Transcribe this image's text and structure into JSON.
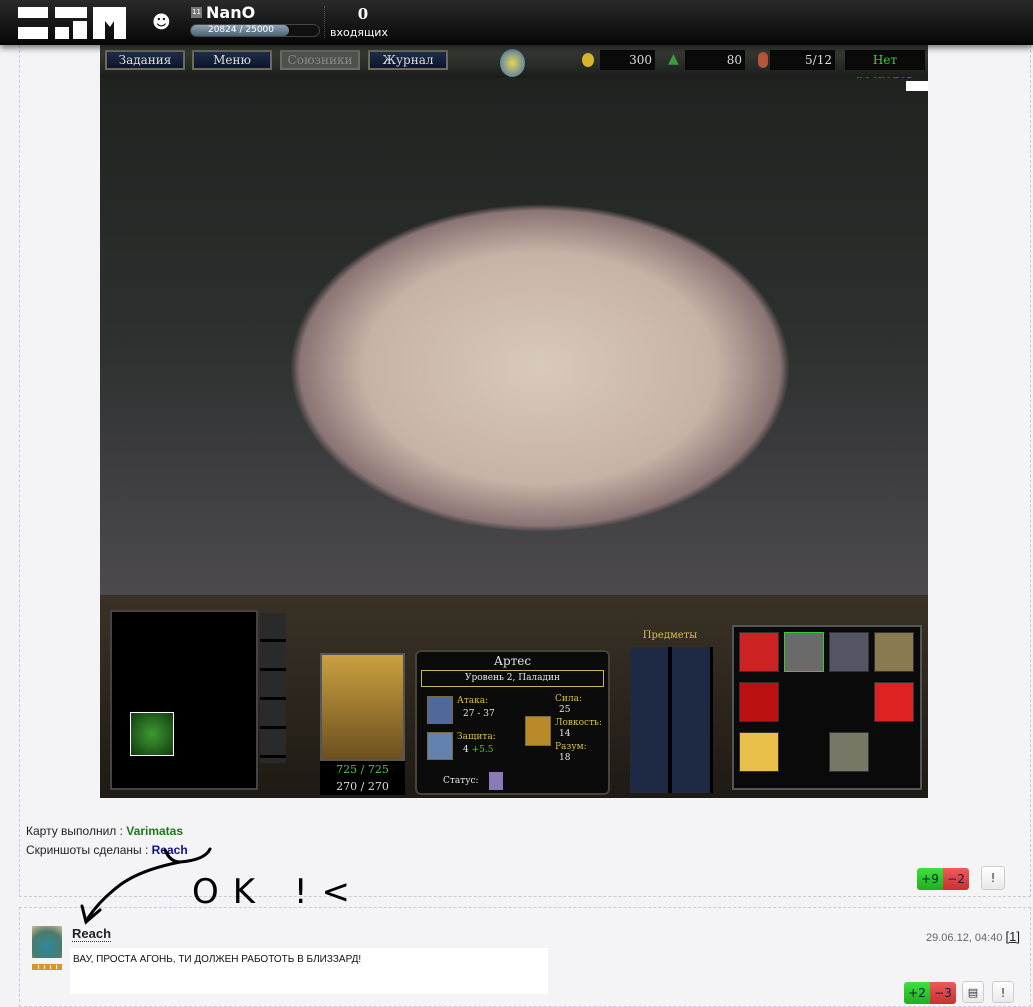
{
  "header": {
    "user_level": "11",
    "username": "NanO",
    "xp": "20824 / 25000",
    "xp_fraction": 0.833,
    "inbox_count": "0",
    "inbox_label": "входящих"
  },
  "game": {
    "buttons": [
      "Задания",
      "Меню",
      "Союзники",
      "Журнал"
    ],
    "gold": "300",
    "lumber": "80",
    "food": "5/12",
    "upkeep": "Нет расходов",
    "items_label": "Предметы",
    "hero_name": "Артес",
    "hero_class": "Уровень 2, Паладин",
    "attack_label": "Атака:",
    "attack": "27 - 37",
    "armor_label": "Защита:",
    "armor": "4",
    "armor_bonus": "+5.5",
    "str_label": "Сила:",
    "str": "25",
    "agi_label": "Ловкость:",
    "agi": "14",
    "int_label": "Разум:",
    "int": "18",
    "status_label": "Статус:",
    "hp": "725 / 725",
    "mana": "270 / 270"
  },
  "credits": {
    "map_label": "Карту выполнил :",
    "map_author": "Varimatas",
    "shots_label": "Скриншоты сделаны :",
    "shots_author": "Reach",
    "colors": {
      "map_author": "#1a7a1a",
      "shots_author": "#101080"
    }
  },
  "post_votes": {
    "plus": "+9",
    "minus": "−2",
    "report": "!"
  },
  "annotation": "OK !<",
  "comment": {
    "author": "Reach",
    "date": "29.06.12, 04:40",
    "number": "[1]",
    "text": "ВАУ, ПРОСТА АГОНЬ, ТИ ДОЛЖЕН РАБОТОТЬ В БЛИЗЗАРД!",
    "votes": {
      "plus": "+2",
      "minus": "−3",
      "report": "!"
    }
  }
}
